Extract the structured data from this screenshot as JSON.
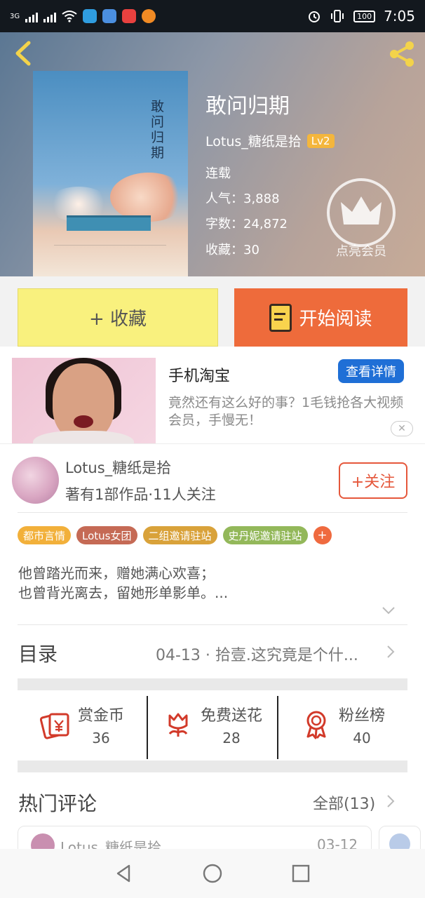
{
  "status_bar": {
    "network": "3G",
    "battery": "100",
    "time": "7:05",
    "icons": [
      "signal-icon",
      "wifi-icon",
      "app-icon-qq",
      "app-icon-browser",
      "app-icon-video",
      "app-icon-taobao",
      "alarm-icon",
      "vibrate-icon",
      "battery-icon"
    ]
  },
  "header": {
    "back_icon": "chevron-left-icon",
    "share_icon": "share-icon",
    "book_title": "敢问归期",
    "cover_vertical_title": "敢问归期",
    "author": "Lotus_糖纸是拾",
    "level_badge": "Lv2",
    "status": "连载",
    "popularity": "人气：3,888",
    "word_count": "字数：24,872",
    "favorites": "收藏：30",
    "vip_label": "点亮会员"
  },
  "actions": {
    "favorite_label": "+ 收藏",
    "read_label": "开始阅读"
  },
  "ad": {
    "title": "手机淘宝",
    "button": "查看详情",
    "text": "竟然还有这么好的事？1毛钱抢各大视频会员，手慢无！",
    "close": "✕"
  },
  "author_card": {
    "name": "Lotus_糖纸是拾",
    "stats": "著有1部作品·11人关注",
    "follow_label": "+关注"
  },
  "tags": [
    {
      "label": "都市言情",
      "color": "#f2b03a"
    },
    {
      "label": "Lotus女团",
      "color": "#c56a55"
    },
    {
      "label": "二组邀请驻站",
      "color": "#d9a23a"
    },
    {
      "label": "史丹妮邀请驻站",
      "color": "#93b85a"
    }
  ],
  "tag_more": "+",
  "description": {
    "line1": "他曾踏光而来，赠她满心欢喜；",
    "line2": "也曾背光离去，留她形单影单。..."
  },
  "toc": {
    "label": "目录",
    "latest": "04-13 · 拾壹.这究竟是个什..."
  },
  "rewards": [
    {
      "label": "赏金币",
      "value": "36",
      "icon": "red-envelope-icon"
    },
    {
      "label": "免费送花",
      "value": "28",
      "icon": "flower-icon"
    },
    {
      "label": "粉丝榜",
      "value": "40",
      "icon": "medal-icon"
    }
  ],
  "comments": {
    "label": "热门评论",
    "all_label": "全部(13)",
    "first": {
      "name": "Lotus_糖纸是拾",
      "date": "03-12"
    }
  },
  "colors": {
    "accent_orange": "#ee6b3b",
    "favorite_yellow": "#f9f17e",
    "ad_button_blue": "#1f6fd6",
    "follow_red": "#e5573b",
    "icon_red": "#d23a2a"
  }
}
